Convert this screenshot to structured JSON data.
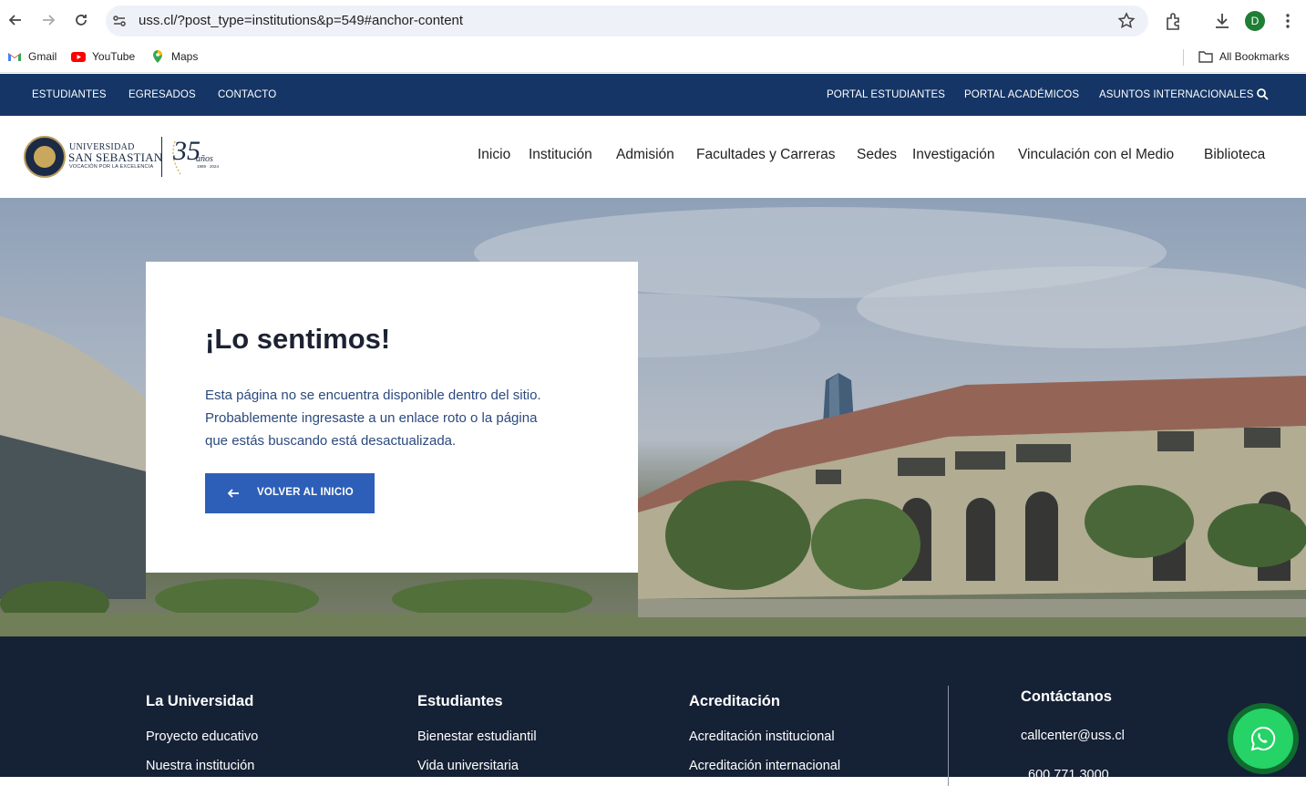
{
  "browser": {
    "url": "uss.cl/?post_type=institutions&p=549#anchor-content",
    "profile_initial": "D",
    "bookmarks": [
      "Gmail",
      "YouTube",
      "Maps"
    ],
    "all_bookmarks": "All Bookmarks"
  },
  "utility_bar": {
    "left_links": [
      "ESTUDIANTES",
      "EGRESADOS",
      "CONTACTO"
    ],
    "right_links": [
      "PORTAL ESTUDIANTES",
      "PORTAL ACADÉMICOS",
      "ASUNTOS INTERNACIONALES"
    ]
  },
  "logo": {
    "line1": "UNIVERSIDAD",
    "line2": "SAN SEBASTIAN",
    "tagline": "VOCACIÓN POR LA EXCELENCIA",
    "anniversary_number": "35",
    "anniversary_word": "años",
    "anniversary_years": "1989 · 2024"
  },
  "main_nav": [
    "Inicio",
    "Institución",
    "Admisión",
    "Facultades y Carreras",
    "Sedes",
    "Investigación",
    "Vinculación con el Medio",
    "Biblioteca"
  ],
  "error": {
    "title": "¡Lo sentimos!",
    "lines": [
      "Esta página no se encuentra disponible dentro del sitio.",
      "Probablemente ingresaste a un enlace roto o la página",
      "que estás buscando está desactualizada."
    ],
    "button_label": "VOLVER AL INICIO"
  },
  "footer": {
    "columns": [
      {
        "heading": "La Universidad",
        "links": [
          "Proyecto educativo",
          "Nuestra institución"
        ]
      },
      {
        "heading": "Estudiantes",
        "links": [
          "Bienestar estudiantil",
          "Vida universitaria"
        ]
      },
      {
        "heading": "Acreditación",
        "links": [
          "Acreditación institucional",
          "Acreditación internacional"
        ]
      }
    ],
    "contact": {
      "heading": "Contáctanos",
      "email": "callcenter@uss.cl",
      "phone": "600 771 3000"
    }
  },
  "colors": {
    "utility_bar": "#153566",
    "button": "#2d5fb8",
    "footer": "#152135",
    "whatsapp": "#25d366"
  }
}
